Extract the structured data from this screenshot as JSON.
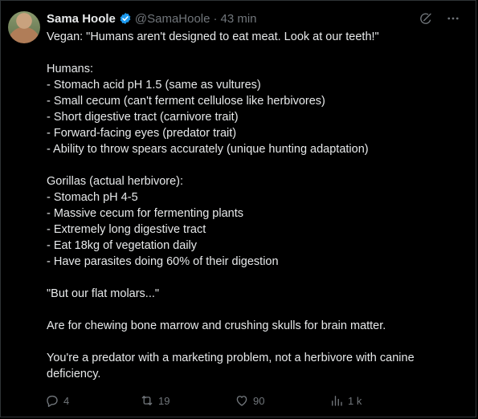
{
  "tweet": {
    "author_name": "Sama Hoole",
    "handle": "@SamaHoole",
    "separator": "·",
    "time": "43 min",
    "body": "Vegan: \"Humans aren't designed to eat meat. Look at our teeth!\"\n\nHumans:\n- Stomach acid pH 1.5 (same as vultures)\n- Small cecum (can't ferment cellulose like herbivores)\n- Short digestive tract (carnivore trait)\n- Forward-facing eyes (predator trait)\n- Ability to throw spears accurately (unique hunting adaptation)\n\nGorillas (actual herbivore):\n- Stomach pH 4-5\n- Massive cecum for fermenting plants\n- Extremely long digestive tract\n- Eat 18kg of vegetation daily\n- Have parasites doing 60% of their digestion\n\n\"But our flat molars...\"\n\nAre for chewing bone marrow and crushing skulls for brain matter.\n\nYou're a predator with a marketing problem, not a herbivore with canine deficiency.",
    "stats": {
      "replies": "4",
      "reposts": "19",
      "likes": "90",
      "views": "1 k"
    }
  },
  "icons": {
    "verified": "verified-badge-icon",
    "grok": "grok-icon",
    "more": "more-icon",
    "reply": "reply-icon",
    "repost": "repost-icon",
    "like": "heart-icon",
    "views": "views-icon",
    "bookmark": "bookmark-icon",
    "share": "share-icon"
  },
  "colors": {
    "background": "#000000",
    "text": "#e7e9ea",
    "muted": "#71767b",
    "verified": "#1d9bf0",
    "border": "#2f3336"
  }
}
